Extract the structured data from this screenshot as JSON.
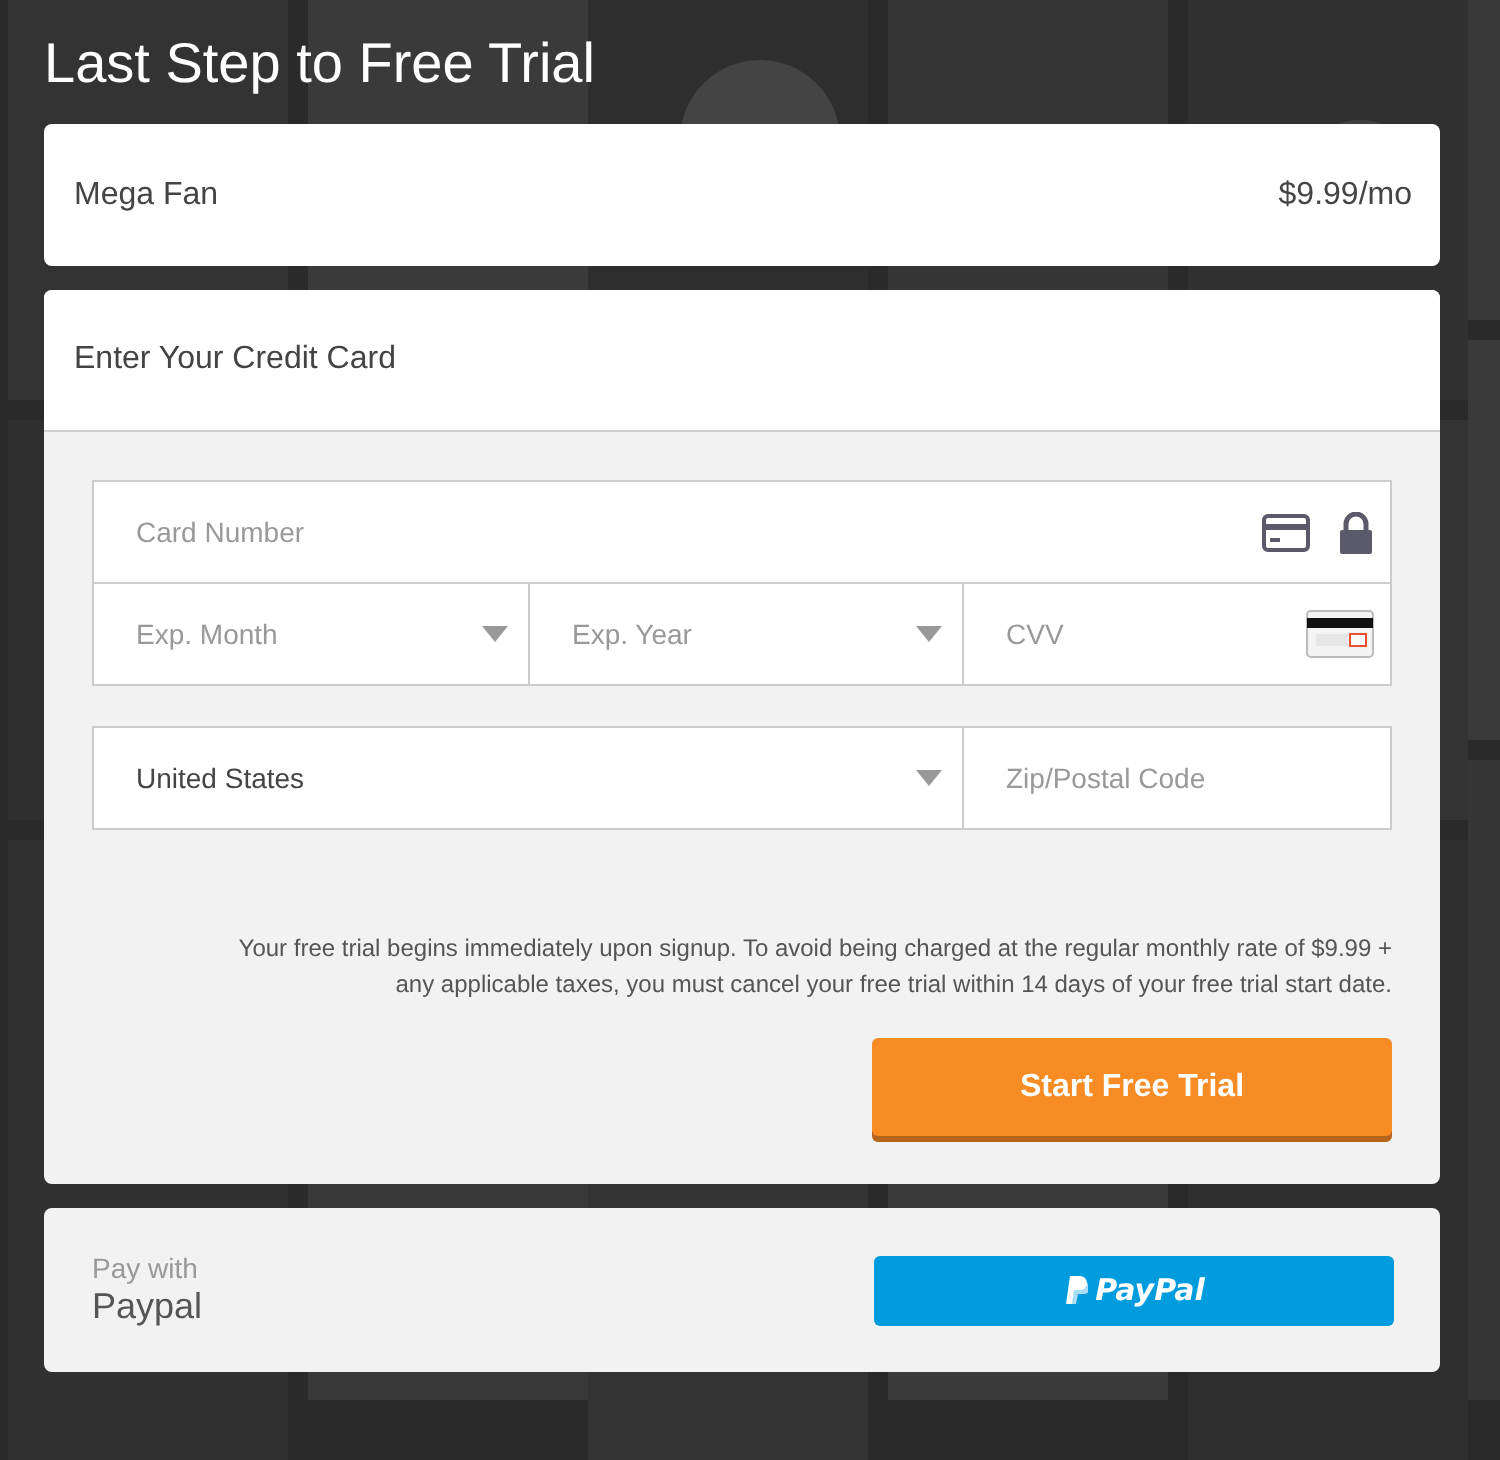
{
  "page": {
    "title": "Last Step to Free Trial"
  },
  "plan": {
    "name": "Mega Fan",
    "price": "$9.99/mo"
  },
  "card_form": {
    "heading": "Enter Your Credit Card",
    "card_number": {
      "placeholder": "Card Number"
    },
    "exp_month": {
      "placeholder": "Exp. Month"
    },
    "exp_year": {
      "placeholder": "Exp. Year"
    },
    "cvv": {
      "placeholder": "CVV"
    },
    "country": {
      "value": "United States"
    },
    "zip": {
      "placeholder": "Zip/Postal Code"
    },
    "disclaimer": "Your free trial begins immediately upon signup. To avoid being charged at the regular monthly rate of $9.99 + any applicable taxes, you must cancel your free trial within 14 days of your free trial start date.",
    "submit": "Start Free Trial"
  },
  "paypal": {
    "caption": "Pay with",
    "name": "Paypal",
    "button": "PayPal"
  }
}
